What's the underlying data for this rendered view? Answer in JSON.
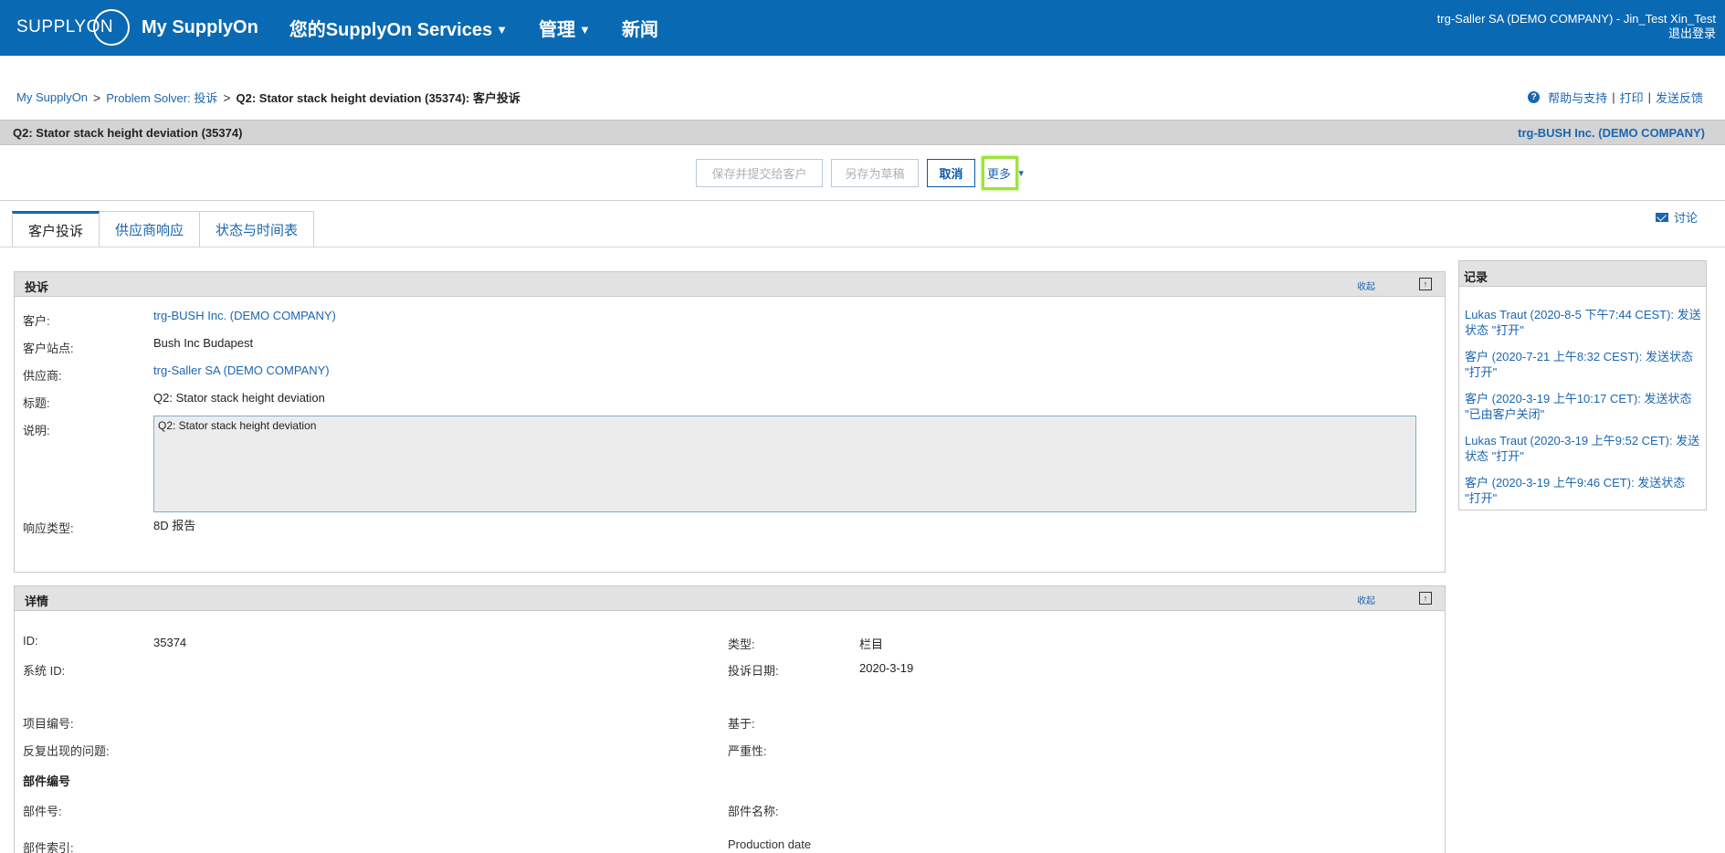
{
  "header": {
    "logo_text": "SUPPLYON",
    "nav": [
      {
        "label": "My SupplyOn",
        "has_menu": false
      },
      {
        "label": "您的SupplyOn Services",
        "has_menu": true
      },
      {
        "label": "管理",
        "has_menu": true
      },
      {
        "label": "新闻",
        "has_menu": false
      }
    ],
    "user": "trg-Saller SA (DEMO COMPANY) - Jin_Test Xin_Test",
    "logout": "退出登录"
  },
  "breadcrumb": {
    "items": [
      "My SupplyOn",
      "Problem Solver: 投诉"
    ],
    "current": "Q2: Stator stack height deviation (35374): 客户投诉",
    "separator": ">"
  },
  "help_links": {
    "help": "帮助与支持",
    "print": "打印",
    "feedback": "发送反馈",
    "pipe": "|"
  },
  "titlebar": {
    "title": "Q2: Stator stack height deviation (35374)",
    "company": "trg-BUSH Inc. (DEMO COMPANY)"
  },
  "actions": {
    "save_submit": "保存并提交给客户",
    "save_draft": "另存为草稿",
    "cancel": "取消",
    "more": "更多"
  },
  "tabs": [
    {
      "label": "客户投诉",
      "active": true
    },
    {
      "label": "供应商响应",
      "active": false
    },
    {
      "label": "状态与时间表",
      "active": false
    }
  ],
  "discuss": "讨论",
  "complaint_panel": {
    "title": "投诉",
    "collapse": "收起",
    "fields": {
      "customer_label": "客户:",
      "customer_value": "trg-BUSH Inc. (DEMO COMPANY)",
      "site_label": "客户站点:",
      "site_value": "Bush Inc Budapest",
      "supplier_label": "供应商:",
      "supplier_value": "trg-Saller SA (DEMO COMPANY)",
      "title_label": "标题:",
      "title_value": "Q2: Stator stack height deviation",
      "desc_label": "说明:",
      "desc_value": "Q2: Stator stack height deviation",
      "response_label": "响应类型:",
      "response_value": "8D 报告"
    }
  },
  "details_panel": {
    "title": "详情",
    "collapse": "收起",
    "fields": {
      "id_label": "ID:",
      "id_value": "35374",
      "type_label": "类型:",
      "type_value": "栏目",
      "sysid_label": "系统 ID:",
      "date_label": "投诉日期:",
      "date_value": "2020-3-19",
      "project_label": "项目编号:",
      "based_label": "基于:",
      "repeat_label": "反复出现的问题:",
      "severity_label": "严重性:",
      "part_heading": "部件编号",
      "partno_label": "部件号:",
      "partname_label": "部件名称:",
      "partindex_label": "部件索引:",
      "proddate_label": "Production date"
    }
  },
  "records_panel": {
    "title": "记录",
    "entries": [
      "Lukas Traut (2020-8-5 下午7:44 CEST): 发送状态 \"打开\"",
      "客户 (2020-7-21 上午8:32 CEST): 发送状态 \"打开\"",
      "客户 (2020-3-19 上午10:17 CET): 发送状态 \"已由客户关闭\"",
      "Lukas Traut (2020-3-19 上午9:52 CET): 发送状态 \"打开\"",
      "客户 (2020-3-19 上午9:46 CET): 发送状态 \"打开\""
    ]
  },
  "colors": {
    "brand_blue": "#0a69b3",
    "link_blue": "#1b66b1",
    "highlight_green": "#9ee23c"
  }
}
